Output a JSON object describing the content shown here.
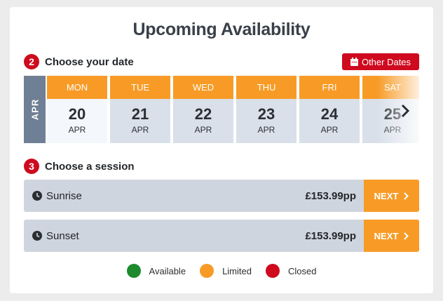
{
  "title": "Upcoming Availability",
  "step_date": {
    "number": "2",
    "label": "Choose your date"
  },
  "other_dates_label": "Other Dates",
  "month_label": "APR",
  "days": [
    {
      "weekday": "MON",
      "day": "20",
      "month": "APR"
    },
    {
      "weekday": "TUE",
      "day": "21",
      "month": "APR"
    },
    {
      "weekday": "WED",
      "day": "22",
      "month": "APR"
    },
    {
      "weekday": "THU",
      "day": "23",
      "month": "APR"
    },
    {
      "weekday": "FRI",
      "day": "24",
      "month": "APR"
    },
    {
      "weekday": "SAT",
      "day": "25",
      "month": "APR"
    }
  ],
  "step_session": {
    "number": "3",
    "label": "Choose a session"
  },
  "sessions": [
    {
      "name": "Sunrise",
      "price": "£153.99pp",
      "button": "NEXT"
    },
    {
      "name": "Sunset",
      "price": "£153.99pp",
      "button": "NEXT"
    }
  ],
  "legend": [
    {
      "label": "Available",
      "color": "#1e8a2e"
    },
    {
      "label": "Limited",
      "color": "#f79b26"
    },
    {
      "label": "Closed",
      "color": "#cf0a1e"
    }
  ]
}
